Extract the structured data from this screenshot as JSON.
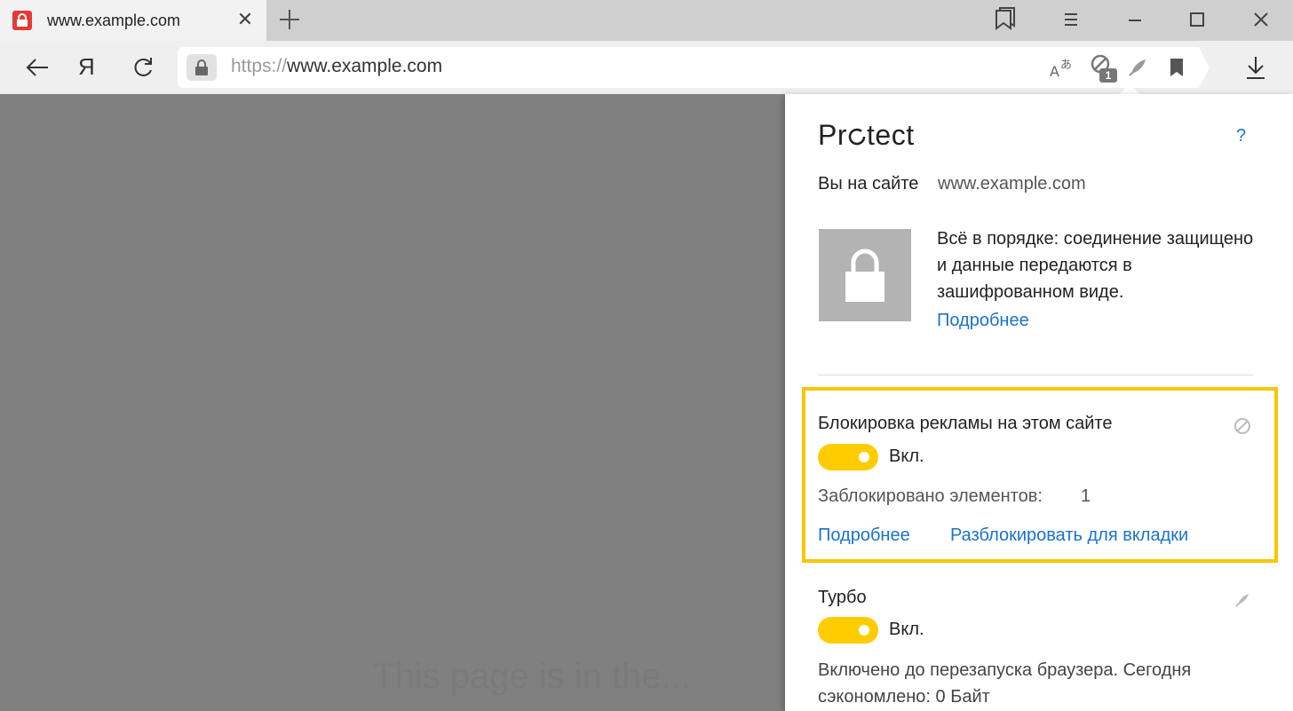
{
  "tab": {
    "title": "www.example.com",
    "close": "✕"
  },
  "toolbar": {
    "yandex_logo": "Я",
    "url_scheme": "https://",
    "url_host": "www.example.com",
    "blocked_badge": "1"
  },
  "page": {
    "faint_text": "This page is in the..."
  },
  "protect": {
    "title_pre": "Pr",
    "title_post": "tect",
    "help": "?",
    "site_label": "Вы на сайте",
    "site_host": "www.example.com",
    "secure_message": "Всё в порядке: соединение защищено и данные передаются в зашифрованном виде.",
    "more_link": "Подробнее",
    "adblock": {
      "title": "Блокировка рекламы на этом сайте",
      "toggle_label": "Вкл.",
      "blocked_label": "Заблокировано элементов:",
      "blocked_count": "1",
      "more_link": "Подробнее",
      "unblock_link": "Разблокировать для вкладки"
    },
    "turbo": {
      "title": "Турбо",
      "toggle_label": "Вкл.",
      "description": "Включено до перезапуска браузера. Сегодня сэкономлено: 0 Байт"
    }
  },
  "colors": {
    "accent": "#ffcc00",
    "link": "#1a73c8",
    "highlight": "#f5c800",
    "favicon": "#e53935"
  }
}
